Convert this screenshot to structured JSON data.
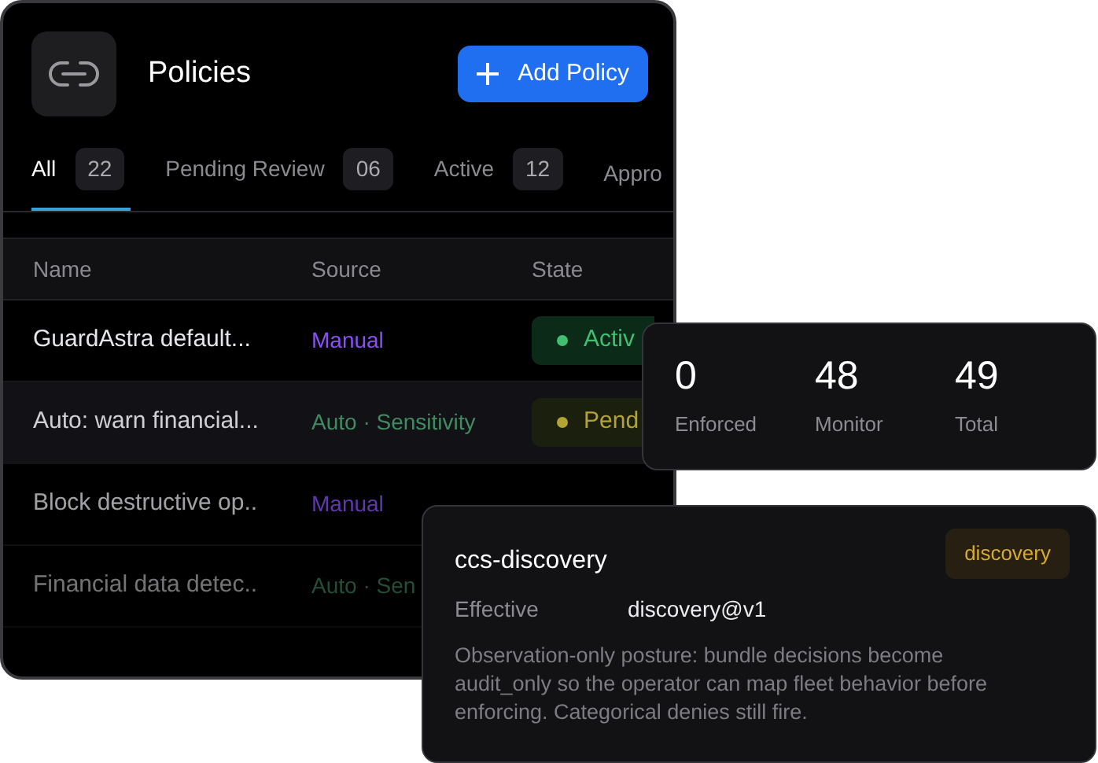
{
  "header": {
    "title": "Policies",
    "add_button": "Add Policy"
  },
  "tabs": [
    {
      "label": "All",
      "count": "22",
      "selected": true
    },
    {
      "label": "Pending Review",
      "count": "06",
      "selected": false
    },
    {
      "label": "Active",
      "count": "12",
      "selected": false
    },
    {
      "label": "Appro",
      "selected": false
    }
  ],
  "table": {
    "columns": [
      "Name",
      "Source",
      "State"
    ],
    "rows": [
      {
        "name": "GuardAstra default...",
        "source": {
          "text": "Manual",
          "kind": "manual"
        },
        "state": {
          "text": "Activ",
          "kind": "active"
        },
        "selected": false
      },
      {
        "name": "Auto: warn financial...",
        "source": {
          "text": "Auto · Sensitivity",
          "kind": "auto"
        },
        "state": {
          "text": "Pend",
          "kind": "pending"
        },
        "selected": true
      },
      {
        "name": "Block destructive op..",
        "source": {
          "text": "Manual",
          "kind": "manual"
        },
        "selected": false
      },
      {
        "name": "Financial data detec..",
        "source": {
          "text": "Auto · Sen",
          "kind": "auto"
        },
        "selected": false
      }
    ]
  },
  "stats": [
    {
      "value": "0",
      "label": "Enforced"
    },
    {
      "value": "48",
      "label": "Monitor"
    },
    {
      "value": "49",
      "label": "Total"
    }
  ],
  "detail": {
    "title": "ccs-discovery",
    "badge": "discovery",
    "field_label": "Effective",
    "field_value": "discovery@v1",
    "description": "Observation-only posture: bundle decisions become audit_only so the operator can map fleet behavior before enforcing. Categorical denies still fire."
  }
}
